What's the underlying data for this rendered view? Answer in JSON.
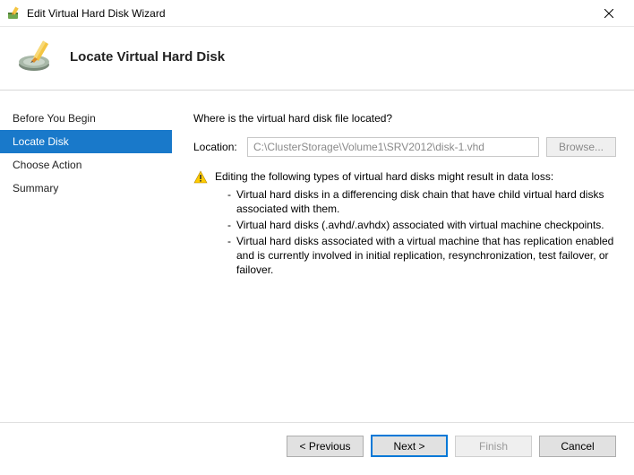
{
  "window": {
    "title": "Edit Virtual Hard Disk Wizard"
  },
  "header": {
    "page_title": "Locate Virtual Hard Disk"
  },
  "sidebar": {
    "items": [
      {
        "label": "Before You Begin",
        "selected": false
      },
      {
        "label": "Locate Disk",
        "selected": true
      },
      {
        "label": "Choose Action",
        "selected": false
      },
      {
        "label": "Summary",
        "selected": false
      }
    ]
  },
  "content": {
    "prompt": "Where is the virtual hard disk file located?",
    "location_label": "Location:",
    "location_value": "C:\\ClusterStorage\\Volume1\\SRV2012\\disk-1.vhd",
    "browse_label": "Browse...",
    "warning_heading": "Editing the following types of virtual hard disks might result in data loss:",
    "warnings": [
      "Virtual hard disks in a differencing disk chain that have child virtual hard disks associated with them.",
      "Virtual hard disks (.avhd/.avhdx) associated with virtual machine checkpoints.",
      "Virtual hard disks associated with a virtual machine that has replication enabled and is currently involved in initial replication, resynchronization, test failover, or failover."
    ]
  },
  "footer": {
    "previous": "< Previous",
    "next": "Next >",
    "finish": "Finish",
    "cancel": "Cancel"
  }
}
